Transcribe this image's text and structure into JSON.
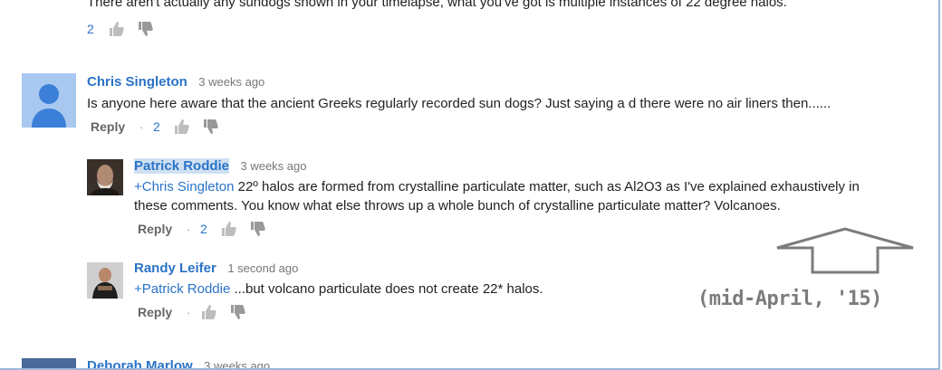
{
  "comments": [
    {
      "text": "There aren't actually any sundogs shown in your timelapse, what you've got is multiple instances of 22 degree halos.",
      "likes": "2"
    },
    {
      "author": "Chris Singleton",
      "time": "3 weeks ago",
      "text": "Is anyone here aware that the ancient Greeks regularly recorded sun dogs?  Just saying a d there were no air liners then......",
      "reply_label": "Reply",
      "dot": "·",
      "likes": "2"
    },
    {
      "author": "Patrick Roddie",
      "time": "3 weeks ago",
      "mention": "+Chris Singleton",
      "text_line1": " 22º halos are formed from crystalline particulate matter, such as Al2O3 as I've explained exhaustively in",
      "text_line2": "these comments. You know what else throws up a whole bunch of crystalline particulate matter? Volcanoes.",
      "reply_label": "Reply",
      "dot": "·",
      "likes": "2"
    },
    {
      "author": "Randy Leifer",
      "time": "1 second ago",
      "mention": "+Patrick Roddie",
      "text": " ...but volcano particulate does not create 22* halos.",
      "reply_label": "Reply",
      "dot": "·"
    },
    {
      "author": "Deborah Marlow",
      "time": "3 weeks ago"
    }
  ],
  "annotation": {
    "text": "(mid-April, '15)",
    "arrow_icon": "up-arrow-outline-icon"
  },
  "colors": {
    "author": "#2a73c7",
    "annotation": "#7c7c7c"
  }
}
